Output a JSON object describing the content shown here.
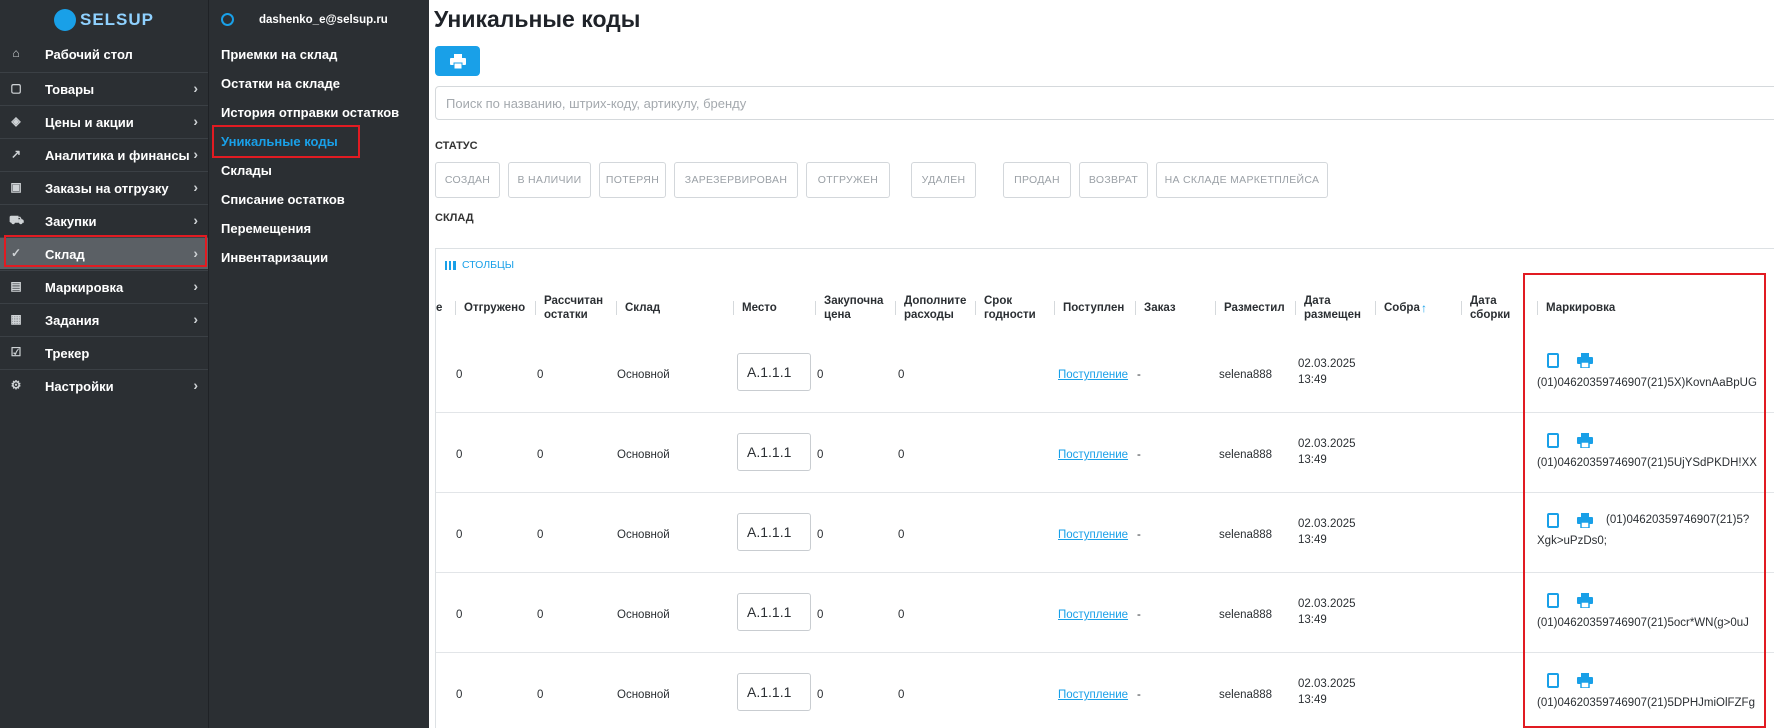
{
  "brand": {
    "logo_text": "SELSUP",
    "color": "#19a0e8"
  },
  "user": {
    "email": "dashenko_e@selsup.ru"
  },
  "sidebar": {
    "items": [
      {
        "label": "Рабочий стол",
        "icon": "home-icon",
        "has_chevron": false
      },
      {
        "label": "Товары",
        "icon": "bag-icon",
        "has_chevron": true
      },
      {
        "label": "Цены и акции",
        "icon": "tag-icon",
        "has_chevron": true
      },
      {
        "label": "Аналитика и финансы",
        "icon": "chart-icon",
        "has_chevron": true
      },
      {
        "label": "Заказы на отгрузку",
        "icon": "box-icon",
        "has_chevron": true
      },
      {
        "label": "Закупки",
        "icon": "cart-icon",
        "has_chevron": true
      },
      {
        "label": "Склад",
        "icon": "check-circle-icon",
        "has_chevron": true,
        "active": true
      },
      {
        "label": "Маркировка",
        "icon": "barcode-icon",
        "has_chevron": true
      },
      {
        "label": "Задания",
        "icon": "calendar-icon",
        "has_chevron": true
      },
      {
        "label": "Трекер",
        "icon": "checkbox-icon",
        "has_chevron": false
      },
      {
        "label": "Настройки",
        "icon": "gear-icon",
        "has_chevron": true
      }
    ]
  },
  "subnav": {
    "items": [
      {
        "label": "Приемки на склад"
      },
      {
        "label": "Остатки на складе"
      },
      {
        "label": "История отправки остатков"
      },
      {
        "label": "Уникальные коды",
        "active": true
      },
      {
        "label": "Склады"
      },
      {
        "label": "Списание остатков"
      },
      {
        "label": "Перемещения"
      },
      {
        "label": "Инвентаризации"
      }
    ]
  },
  "page": {
    "title": "Уникальные коды",
    "search_placeholder": "Поиск по названию, штрих-коду, артикулу, бренду",
    "status_label": "СТАТУС",
    "warehouse_label": "СКЛАД",
    "status_chips": [
      "СОЗДАН",
      "В НАЛИЧИИ",
      "ПОТЕРЯН",
      "ЗАРЕЗЕРВИРОВАН",
      "ОТГРУЖЕН",
      "УДАЛЕН",
      "ПРОДАН",
      "ВОЗВРАТ",
      "НА СКЛАДЕ МАРКЕТПЛЕЙСА"
    ],
    "columns_button": "СТОЛБЦЫ"
  },
  "table": {
    "headers": [
      "е",
      "Отгружено",
      "Рассчитан\nостатки",
      "Склад",
      "Место",
      "Закупочна\nцена",
      "Дополните\nрасходы",
      "Срок\nгодности",
      "Поступлен",
      "Заказ",
      "Разместил",
      "Дата\nразмещен",
      "Собра",
      "Дата\nсборки",
      "Маркировка"
    ],
    "rows": [
      {
        "shipped": "0",
        "calc": "0",
        "warehouse": "Основной",
        "place": "А.1.1.1",
        "purchase": "0",
        "extra": "0",
        "receipt": "Поступление",
        "order": "-",
        "placed_by": "selena888",
        "date": "02.03.2025",
        "time": "13:49",
        "code": "(01)04620359746907(21)5X)KovnAaBpUG"
      },
      {
        "shipped": "0",
        "calc": "0",
        "warehouse": "Основной",
        "place": "А.1.1.1",
        "purchase": "0",
        "extra": "0",
        "receipt": "Поступление",
        "order": "-",
        "placed_by": "selena888",
        "date": "02.03.2025",
        "time": "13:49",
        "code": "(01)04620359746907(21)5UjYSdPKDH!XX"
      },
      {
        "shipped": "0",
        "calc": "0",
        "warehouse": "Основной",
        "place": "А.1.1.1",
        "purchase": "0",
        "extra": "0",
        "receipt": "Поступление",
        "order": "-",
        "placed_by": "selena888",
        "date": "02.03.2025",
        "time": "13:49",
        "code": "(01)04620359746907(21)5?",
        "code_cont": "Xgk>uPzDs0;"
      },
      {
        "shipped": "0",
        "calc": "0",
        "warehouse": "Основной",
        "place": "А.1.1.1",
        "purchase": "0",
        "extra": "0",
        "receipt": "Поступление",
        "order": "-",
        "placed_by": "selena888",
        "date": "02.03.2025",
        "time": "13:49",
        "code": "(01)04620359746907(21)5ocr*WN(g>0uJ"
      },
      {
        "shipped": "0",
        "calc": "0",
        "warehouse": "Основной",
        "place": "А.1.1.1",
        "purchase": "0",
        "extra": "0",
        "receipt": "Поступление",
        "order": "-",
        "placed_by": "selena888",
        "date": "02.03.2025",
        "time": "13:49",
        "code": "(01)04620359746907(21)5DPHJmiOlFZFg"
      }
    ]
  },
  "colors": {
    "highlight": "#e11b22",
    "sidebar_bg": "#2b2f33",
    "accent": "#19a0e8"
  }
}
